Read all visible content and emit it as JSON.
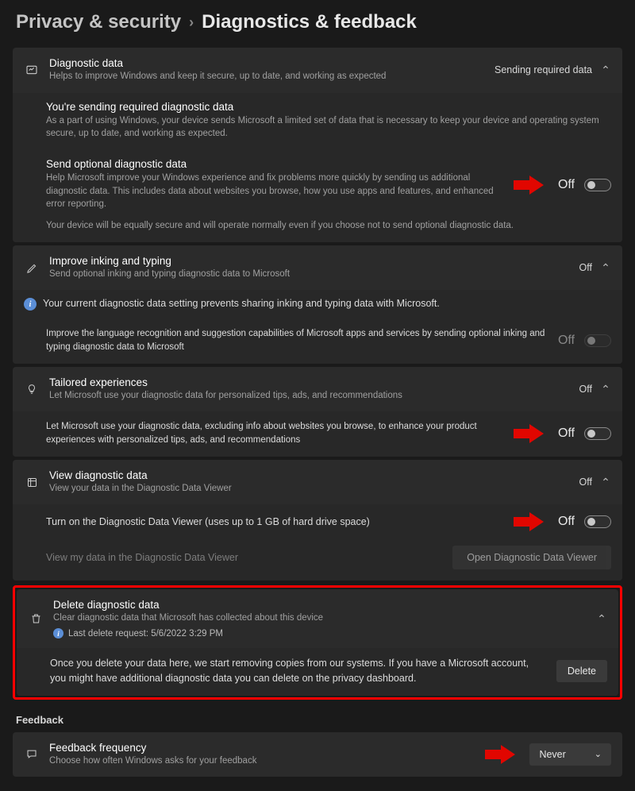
{
  "breadcrumb": {
    "parent": "Privacy & security",
    "current": "Diagnostics & feedback"
  },
  "diag": {
    "title": "Diagnostic data",
    "subtitle": "Helps to improve Windows and keep it secure, up to date, and working as expected",
    "status": "Sending required data",
    "required_title": "You're sending required diagnostic data",
    "required_text": "As a part of using Windows, your device sends Microsoft a limited set of data that is necessary to keep your device and operating system secure, up to date, and working as expected.",
    "opt_title": "Send optional diagnostic data",
    "opt_text": "Help Microsoft improve your Windows experience and fix problems more quickly by sending us additional diagnostic data. This includes data about websites you browse, how you use apps and features, and enhanced error reporting.",
    "opt_note": "Your device will be equally secure and will operate normally even if you choose not to send optional diagnostic data.",
    "opt_state": "Off"
  },
  "inking": {
    "title": "Improve inking and typing",
    "subtitle": "Send optional inking and typing diagnostic data to Microsoft",
    "state": "Off",
    "info": "Your current diagnostic data setting prevents sharing inking and typing data with Microsoft.",
    "body_text": "Improve the language recognition and suggestion capabilities of Microsoft apps and services by sending optional inking and typing diagnostic data to Microsoft",
    "body_state": "Off"
  },
  "tailored": {
    "title": "Tailored experiences",
    "subtitle": "Let Microsoft use your diagnostic data for personalized tips, ads, and recommendations",
    "state": "Off",
    "body_text": "Let Microsoft use your diagnostic data, excluding info about websites you browse, to enhance your product experiences with personalized tips, ads, and recommendations",
    "body_state": "Off"
  },
  "view": {
    "title": "View diagnostic data",
    "subtitle": "View your data in the Diagnostic Data Viewer",
    "state": "Off",
    "body_text": "Turn on the Diagnostic Data Viewer (uses up to 1 GB of hard drive space)",
    "body_state": "Off",
    "link": "View my data in the Diagnostic Data Viewer",
    "button": "Open Diagnostic Data Viewer"
  },
  "delete": {
    "title": "Delete diagnostic data",
    "subtitle": "Clear diagnostic data that Microsoft has collected about this device",
    "last": "Last delete request: 5/6/2022 3:29 PM",
    "body_text": "Once you delete your data here, we start removing copies from our systems. If you have a Microsoft account, you might have additional diagnostic data you can delete on the privacy dashboard.",
    "button": "Delete"
  },
  "feedback": {
    "section": "Feedback",
    "title": "Feedback frequency",
    "subtitle": "Choose how often Windows asks for your feedback",
    "value": "Never"
  }
}
